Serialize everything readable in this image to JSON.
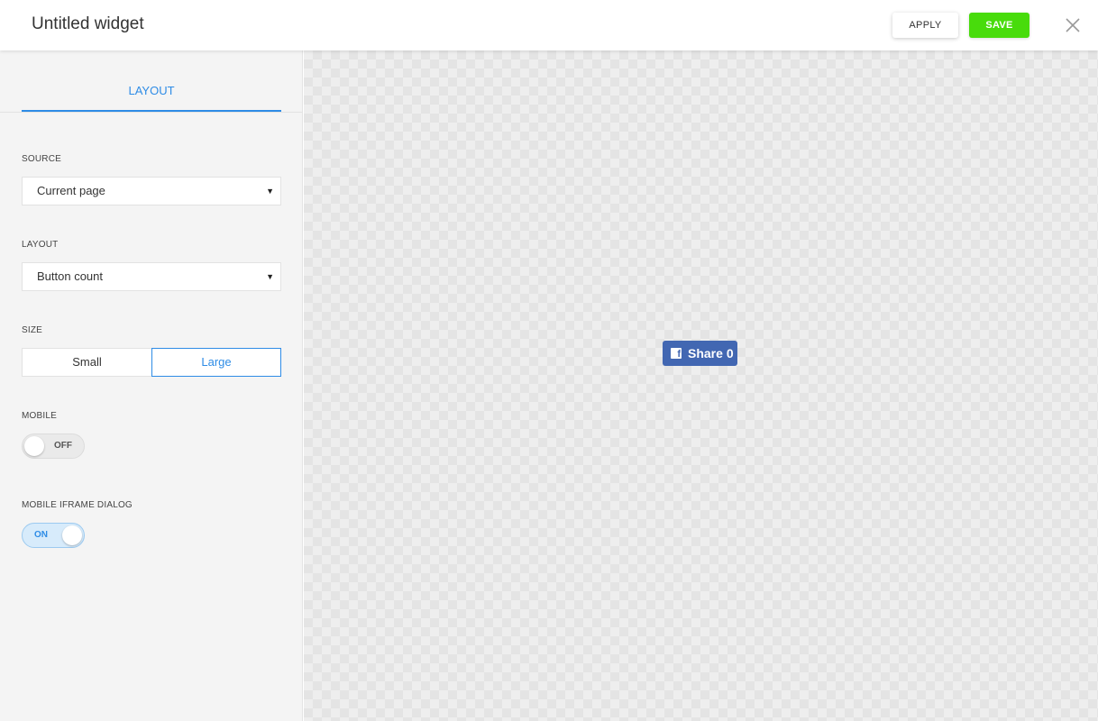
{
  "header": {
    "title": "Untitled widget",
    "apply_label": "APPLY",
    "save_label": "SAVE"
  },
  "sidebar": {
    "tabs": [
      {
        "label": "LAYOUT",
        "active": true
      }
    ],
    "source": {
      "label": "SOURCE",
      "value": "Current page"
    },
    "layout": {
      "label": "LAYOUT",
      "value": "Button count"
    },
    "size": {
      "label": "SIZE",
      "options": [
        "Small",
        "Large"
      ],
      "selected": "Large"
    },
    "mobile": {
      "label": "MOBILE",
      "state": "OFF"
    },
    "mobile_iframe_dialog": {
      "label": "MOBILE IFRAME DIALOG",
      "state": "ON"
    }
  },
  "preview": {
    "share_button": {
      "label": "Share",
      "count": "0"
    }
  },
  "colors": {
    "accent": "#2e8ce6",
    "save": "#48dc0c",
    "facebook": "#4267b2"
  }
}
